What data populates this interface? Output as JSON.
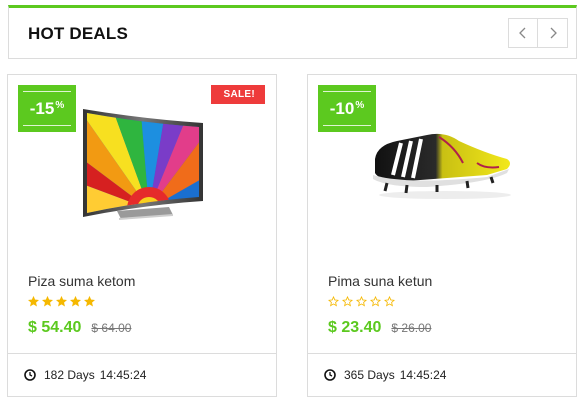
{
  "section": {
    "title": "HOT DEALS",
    "prev_icon": "chevron-left-icon",
    "next_icon": "chevron-right-icon"
  },
  "colors": {
    "accent": "#5cc91f",
    "sale": "#ee3b3b",
    "star": "#f5b800"
  },
  "products": [
    {
      "discount": "-15",
      "discount_unit": "%",
      "sale_label": "SALE!",
      "image": "curved-tv",
      "name": "Piza suma ketom",
      "rating": 5,
      "rating_max": 5,
      "price": "$ 54.40",
      "old_price": "$ 64.00",
      "countdown_days": "182 Days",
      "countdown_time": "14:45:24",
      "clock_icon": "clock-icon"
    },
    {
      "discount": "-10",
      "discount_unit": "%",
      "image": "soccer-cleat",
      "name": "Pima suna ketun",
      "rating": 0,
      "rating_max": 5,
      "price": "$ 23.40",
      "old_price": "$ 26.00",
      "countdown_days": "365 Days",
      "countdown_time": "14:45:24",
      "clock_icon": "clock-icon"
    }
  ]
}
